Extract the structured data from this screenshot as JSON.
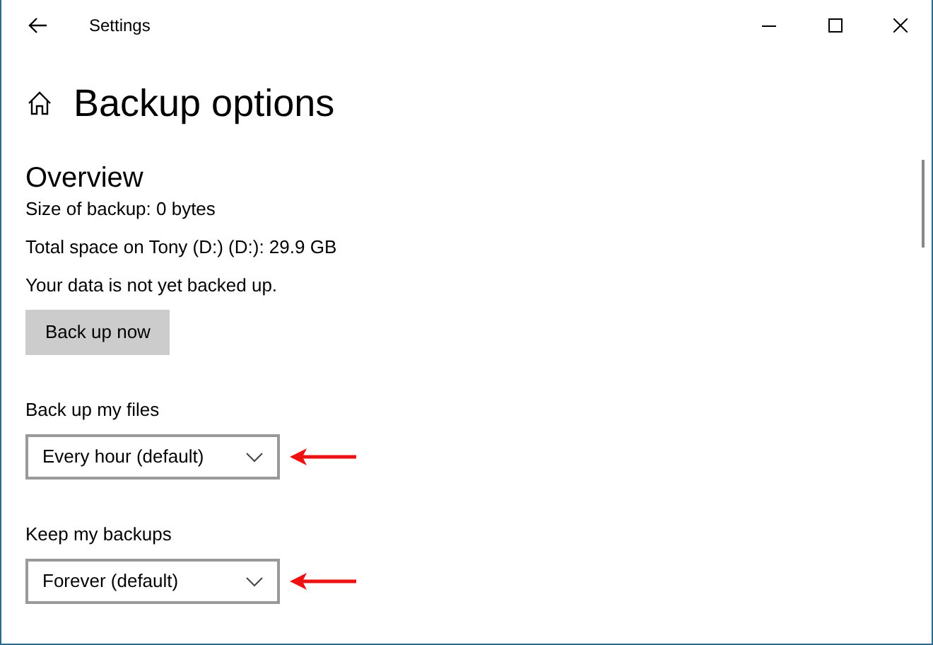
{
  "window": {
    "title": "Settings"
  },
  "page_title": "Backup options",
  "overview": {
    "heading": "Overview",
    "lines": [
      "Size of backup: 0 bytes",
      "Total space on Tony (D:) (D:): 29.9 GB",
      "Your data is not yet backed up."
    ],
    "button": "Back up now"
  },
  "settings": [
    {
      "label": "Back up my files",
      "value": "Every hour (default)",
      "marked": true
    },
    {
      "label": "Keep my backups",
      "value": "Forever (default)",
      "marked": true
    }
  ]
}
